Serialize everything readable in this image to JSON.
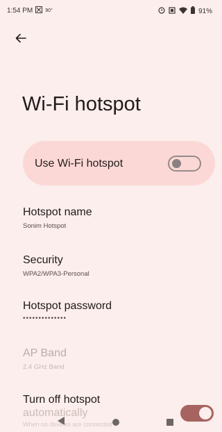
{
  "status_bar": {
    "time": "1:54 PM",
    "temperature": "90°",
    "battery": "91%",
    "icons": [
      "notification-icon",
      "alarm-icon",
      "screenshot-icon",
      "wifi-icon",
      "battery-icon"
    ]
  },
  "header": {
    "back_icon": "arrow-left-icon",
    "title": "Wi-Fi hotspot"
  },
  "main_toggle": {
    "label": "Use Wi-Fi hotspot",
    "enabled": false
  },
  "settings": {
    "hotspot_name": {
      "title": "Hotspot name",
      "value": "Sonim Hotspot"
    },
    "security": {
      "title": "Security",
      "value": "WPA2/WPA3-Personal"
    },
    "password": {
      "title": "Hotspot password",
      "value": "••••••••••••••"
    },
    "ap_band": {
      "title": "AP Band",
      "value": "2.4 GHz Band",
      "disabled": true
    },
    "turn_off": {
      "title": "Turn off hotspot",
      "title_line2": "automatically",
      "value": "When no devices are connected",
      "enabled": true
    }
  },
  "colors": {
    "background": "#fbeeec",
    "card": "#fbd8d6",
    "switch_on": "#a66360"
  },
  "nav_bar": {
    "icons": [
      "nav-back-icon",
      "nav-home-icon",
      "nav-recents-icon"
    ]
  }
}
